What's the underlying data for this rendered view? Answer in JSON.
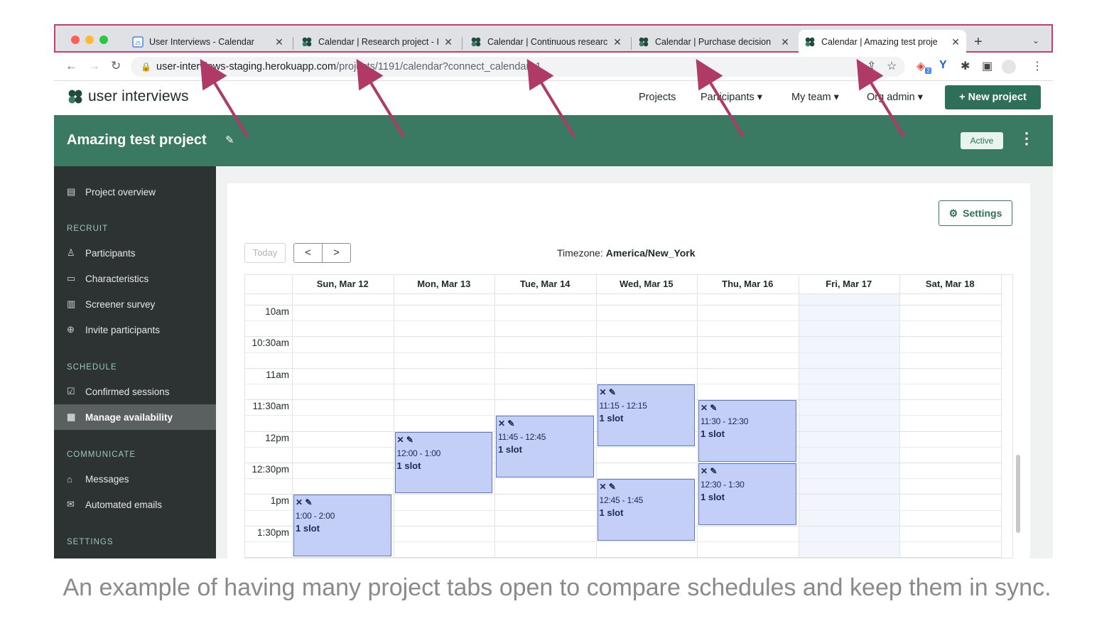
{
  "browser": {
    "tabs": [
      {
        "title": "User Interviews - Calendar",
        "favicon": "google-calendar-icon"
      },
      {
        "title": "Calendar | Research project - I",
        "favicon": "user-interviews-logo-icon"
      },
      {
        "title": "Calendar | Continuous researc",
        "favicon": "user-interviews-logo-icon"
      },
      {
        "title": "Calendar | Purchase decision",
        "favicon": "user-interviews-logo-icon"
      },
      {
        "title": "Calendar | Amazing test proje",
        "favicon": "user-interviews-logo-icon",
        "active": true
      }
    ],
    "favicon_cal_text": "25",
    "close_glyph": "✕",
    "new_tab": "+",
    "tab_menu": "⌄",
    "url_host": "user-interviews-staging.herokuapp.com",
    "url_path": "/projects/1191/calendar?connect_calendar=1",
    "ext_badge": "2"
  },
  "app": {
    "logo_text": "user interviews",
    "nav": {
      "projects": "Projects",
      "participants": "Participants ▾",
      "my_team": "My team ▾",
      "org_admin": "Org admin ▾"
    },
    "new_project": "+  New project"
  },
  "project": {
    "title": "Amazing test project",
    "status": "Active"
  },
  "sidebar": {
    "overview": "Project overview",
    "sections": {
      "recruit": "RECRUIT",
      "schedule": "SCHEDULE",
      "communicate": "COMMUNICATE",
      "settings": "SETTINGS"
    },
    "items": {
      "participants": "Participants",
      "characteristics": "Characteristics",
      "screener": "Screener survey",
      "invite": "Invite participants",
      "confirmed": "Confirmed sessions",
      "manage": "Manage availability",
      "messages": "Messages",
      "automated": "Automated emails"
    }
  },
  "calendar": {
    "settings_label": "Settings",
    "today_label": "Today",
    "prev": "<",
    "next": ">",
    "timezone_label": "Timezone:",
    "timezone_value": "America/New_York",
    "days": [
      "Sun, Mar 12",
      "Mon, Mar 13",
      "Tue, Mar 14",
      "Wed, Mar 15",
      "Thu, Mar 16",
      "Fri, Mar 17",
      "Sat, Mar 18"
    ],
    "times": [
      "10am",
      "10:30am",
      "11am",
      "11:30am",
      "12pm",
      "12:30pm",
      "1pm",
      "1:30pm"
    ],
    "events": [
      {
        "day": 0,
        "start": 13.0,
        "end": 14.0,
        "label": "1:00 - 2:00",
        "slots": "1 slot"
      },
      {
        "day": 1,
        "start": 12.0,
        "end": 13.0,
        "label": "12:00 - 1:00",
        "slots": "1 slot"
      },
      {
        "day": 2,
        "start": 11.75,
        "end": 12.75,
        "label": "11:45 - 12:45",
        "slots": "1 slot"
      },
      {
        "day": 3,
        "start": 11.25,
        "end": 12.25,
        "label": "11:15 - 12:15",
        "slots": "1 slot"
      },
      {
        "day": 3,
        "start": 12.75,
        "end": 13.75,
        "label": "12:45 - 1:45",
        "slots": "1 slot"
      },
      {
        "day": 4,
        "start": 11.5,
        "end": 12.5,
        "label": "11:30 - 12:30",
        "slots": "1 slot"
      },
      {
        "day": 4,
        "start": 12.5,
        "end": 13.5,
        "label": "12:30 - 1:30",
        "slots": "1 slot"
      }
    ]
  },
  "caption": "An example of having many project tabs open to compare schedules and keep them in sync."
}
